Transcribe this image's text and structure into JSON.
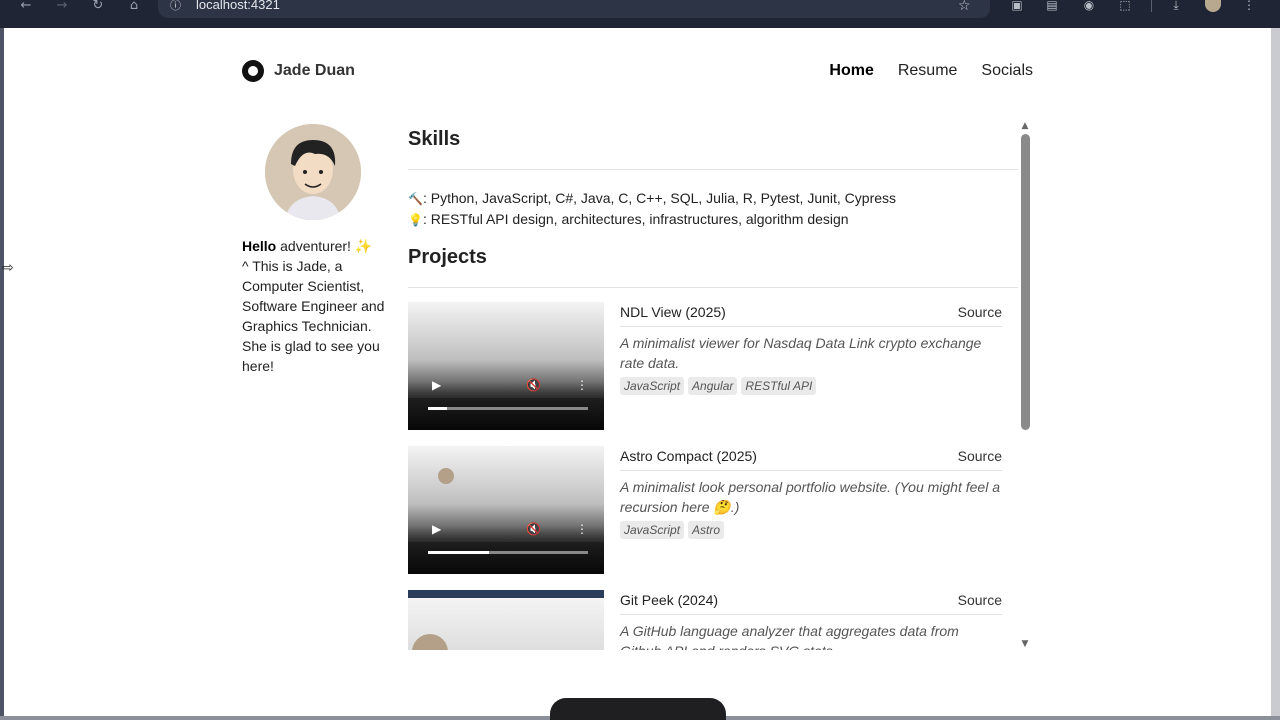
{
  "browser": {
    "url": "localhost:4321",
    "back_icon": "arrow-left-icon",
    "forward_icon": "arrow-right-icon",
    "reload_icon": "reload-icon",
    "home_icon": "home-icon"
  },
  "header": {
    "brand": "Jade Duan",
    "nav": [
      {
        "label": "Home",
        "active": true
      },
      {
        "label": "Resume",
        "active": false
      },
      {
        "label": "Socials",
        "active": false
      }
    ]
  },
  "profile": {
    "hello_bold": "Hello",
    "hello_rest": " adventurer! ✨",
    "line1": "^ This is Jade, a Computer Scientist, Software Engineer and Graphics Technician.",
    "line2": "She is glad to see you here!"
  },
  "skills": {
    "title": "Skills",
    "tools_icon": "🔨",
    "tools": ": Python, JavaScript, C#, Java, C, C++, SQL, Julia, R, Pytest, Junit, Cypress",
    "ideas_icon": "💡",
    "ideas": ": RESTful API design, architectures, infrastructures, algorithm design"
  },
  "projects": {
    "title": "Projects",
    "items": [
      {
        "title": "NDL View (2025)",
        "source": "Source",
        "description": "A minimalist viewer for Nasdaq Data Link crypto exchange rate data.",
        "tags": [
          "JavaScript",
          "Angular",
          "RESTful API"
        ],
        "progress": 0.12
      },
      {
        "title": "Astro Compact (2025)",
        "source": "Source",
        "description": "A minimalist look personal portfolio website. (You might feel a recursion here 🤔.)",
        "tags": [
          "JavaScript",
          "Astro"
        ],
        "progress": 0.38
      },
      {
        "title": "Git Peek (2024)",
        "source": "Source",
        "description": "A GitHub language analyzer that aggregates data from Github API and renders SVG stats.",
        "tags": [],
        "progress": 0
      }
    ]
  }
}
